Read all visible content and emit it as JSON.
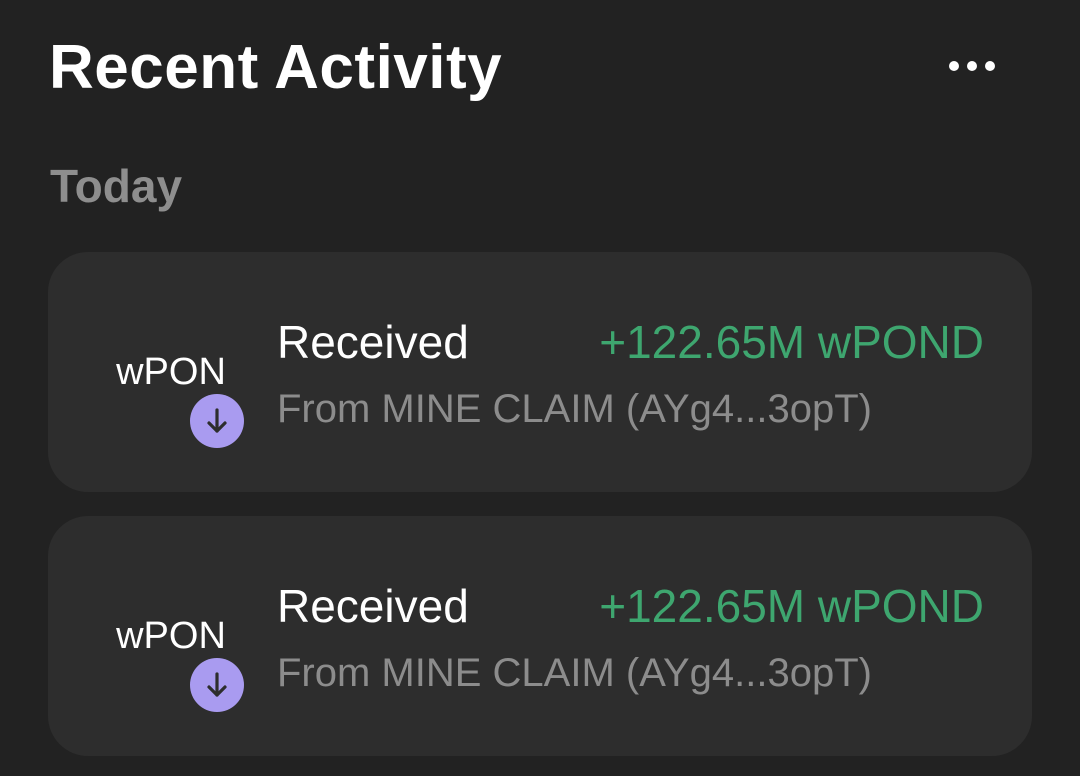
{
  "header": {
    "title": "Recent Activity",
    "more_icon": "ellipsis-horizontal-icon"
  },
  "section": {
    "label": "Today"
  },
  "activities": [
    {
      "token_label": "wPON",
      "badge_icon": "arrow-down-icon",
      "title": "Received",
      "amount": "+122.65M wPOND",
      "subtitle": "From MINE CLAIM (AYg4...3opT)"
    },
    {
      "token_label": "wPON",
      "badge_icon": "arrow-down-icon",
      "title": "Received",
      "amount": "+122.65M wPOND",
      "subtitle": "From MINE CLAIM (AYg4...3opT)"
    }
  ],
  "colors": {
    "background": "#222222",
    "card": "#2d2d2d",
    "amount_positive": "#3ea66f",
    "badge": "#a99bf0",
    "secondary_text": "#8c8c8c"
  }
}
